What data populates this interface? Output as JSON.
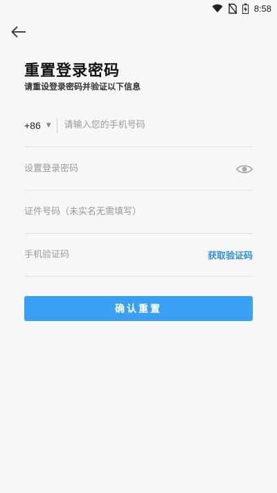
{
  "status_bar": {
    "time": "8:58"
  },
  "header": {
    "title": "重置登录密码",
    "subtitle": "请重设登录密码并验证以下信息"
  },
  "form": {
    "phone": {
      "country_code": "+86",
      "placeholder": "请输入您的手机号码",
      "value": ""
    },
    "password": {
      "placeholder": "设置登录密码",
      "value": ""
    },
    "id_number": {
      "placeholder": "证件号码（未实名无需填写）",
      "value": ""
    },
    "sms_code": {
      "placeholder": "手机验证码",
      "value": "",
      "get_code_label": "获取验证码"
    },
    "submit_label": "确认重置"
  },
  "colors": {
    "accent": "#3aa0f3",
    "link": "#2b8fe3",
    "background": "#f7f7f7"
  }
}
